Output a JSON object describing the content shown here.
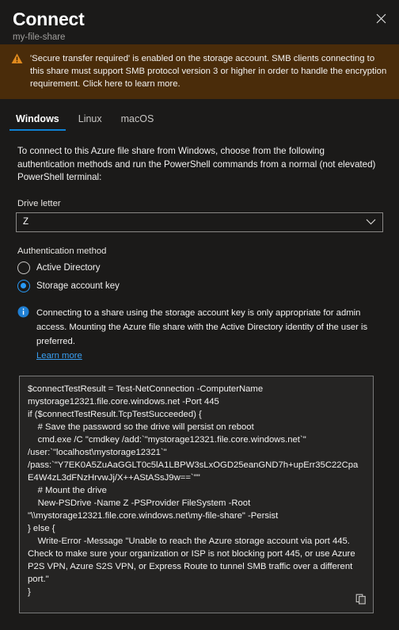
{
  "header": {
    "title": "Connect",
    "subtitle": "my-file-share",
    "close_label": "Close",
    "close_icon": "close-icon"
  },
  "warning": {
    "icon": "warning-triangle-icon",
    "text": "'Secure transfer required' is enabled on the storage account. SMB clients connecting to this share must support SMB protocol version 3 or higher in order to handle the encryption requirement. Click here to learn more.",
    "background_color": "#4a2c0a",
    "icon_color": "#e08a1e"
  },
  "tabs": {
    "items": [
      {
        "label": "Windows",
        "active": true
      },
      {
        "label": "Linux",
        "active": false
      },
      {
        "label": "macOS",
        "active": false
      }
    ],
    "active_underline_color": "#0f82d4"
  },
  "main": {
    "intro": "To connect to this Azure file share from Windows, choose from the following authentication methods and run the PowerShell commands from a normal (not elevated) PowerShell terminal:",
    "drive_letter": {
      "label": "Drive letter",
      "value": "Z",
      "icon": "chevron-down-icon"
    },
    "auth": {
      "label": "Authentication method",
      "options": [
        {
          "label": "Active Directory",
          "selected": false
        },
        {
          "label": "Storage account key",
          "selected": true
        }
      ],
      "selected_color": "#2899f5"
    },
    "info": {
      "icon": "info-circle-icon",
      "text": "Connecting to a share using the storage account key is only appropriate for admin access. Mounting the Azure file share with the Active Directory identity of the user is preferred.",
      "link_label": "Learn more",
      "link_color": "#3aa0f3"
    },
    "code": {
      "content": "$connectTestResult = Test-NetConnection -ComputerName mystorage12321.file.core.windows.net -Port 445\nif ($connectTestResult.TcpTestSucceeded) {\n    # Save the password so the drive will persist on reboot\n    cmd.exe /C \"cmdkey /add:`\"mystorage12321.file.core.windows.net`\" /user:`\"localhost\\mystorage12321`\" /pass:`\"Y7EK0A5ZuAaGGLT0c5lA1LBPW3sLxOGD25eanGND7h+upErr35C22CpaE4W4zL3dFNzHrvwJj/X++AStASsJ9w==`\"\"\n    # Mount the drive\n    New-PSDrive -Name Z -PSProvider FileSystem -Root \"\\\\mystorage12321.file.core.windows.net\\my-file-share\" -Persist\n} else {\n    Write-Error -Message \"Unable to reach the Azure storage account via port 445. Check to make sure your organization or ISP is not blocking port 445, or use Azure P2S VPN, Azure S2S VPN, or Express Route to tunnel SMB traffic over a different port.\"\n}",
      "copy_icon": "copy-icon",
      "copy_label": "Copy to clipboard"
    }
  }
}
